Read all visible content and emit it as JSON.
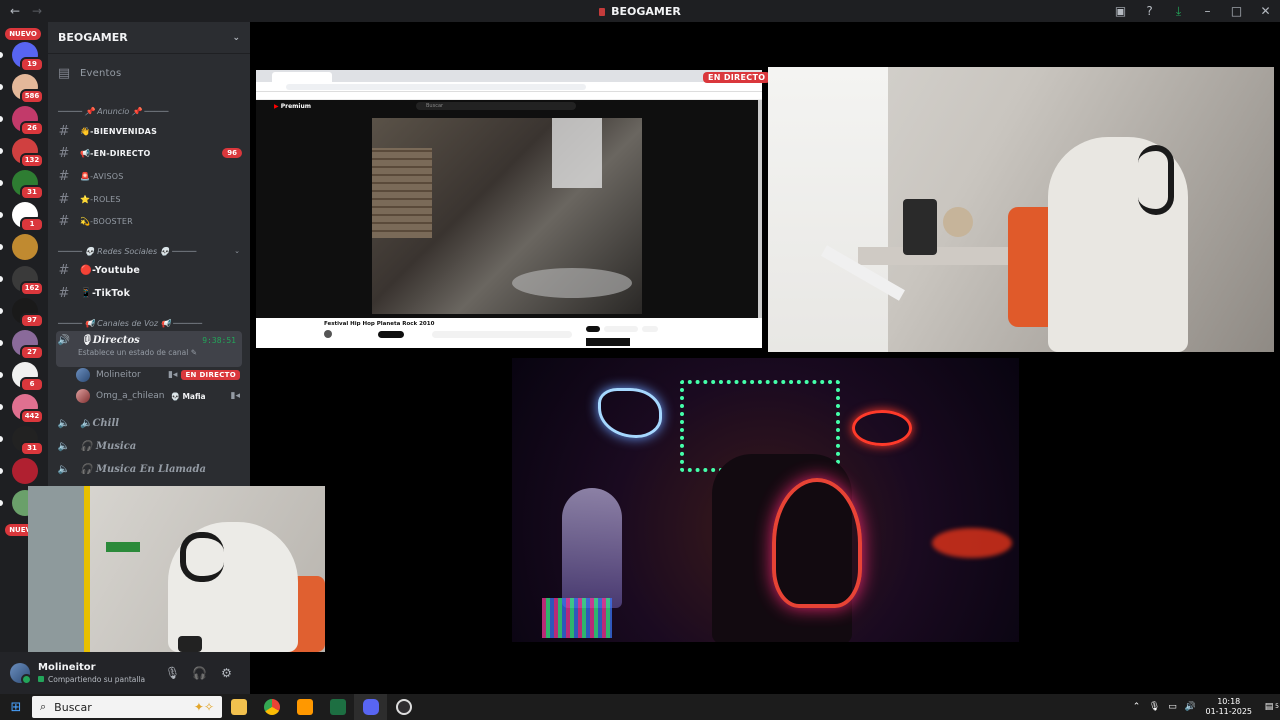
{
  "app": {
    "title": "BEOGAMER"
  },
  "titlebar": {
    "back_icon": "arrow-left-icon",
    "forward_icon": "arrow-right-icon"
  },
  "rail": {
    "top_badge": "NUEVO",
    "servers": [
      {
        "badge": "19",
        "color": "#5865f2"
      },
      {
        "badge": "586",
        "color": "#e4b89a"
      },
      {
        "badge": "26",
        "color": "#c23a6a"
      },
      {
        "badge": "132",
        "color": "#d04040"
      },
      {
        "badge": "31",
        "color": "#2e7d32"
      },
      {
        "badge": "1",
        "color": "#ffffff"
      },
      {
        "badge": "",
        "color": "#c08a30"
      },
      {
        "badge": "162",
        "color": "#3a3a3a"
      },
      {
        "badge": "97",
        "color": "#1a1a1a"
      },
      {
        "badge": "27",
        "color": "#8a6a9a"
      },
      {
        "badge": "6",
        "color": "#f0f0f0"
      },
      {
        "badge": "442",
        "color": "#e07090"
      },
      {
        "badge": "31",
        "color": "#222222"
      },
      {
        "badge": "",
        "color": "#b02030"
      },
      {
        "badge": "",
        "color": "#6aa06a"
      }
    ],
    "bottom_badge": "NUEVO"
  },
  "sidebar": {
    "server_name": "BEOGAMER",
    "events_label": "Eventos",
    "cat_announce": "───── 📌 Anuncio 📌 ─────",
    "channels_announce": [
      {
        "name": "👋-BIENVENIDAS",
        "count": ""
      },
      {
        "name": "📢-EN-DIRECTO",
        "count": "96"
      },
      {
        "name": "🚨-AVISOS",
        "count": ""
      },
      {
        "name": "⭐-ROLES",
        "count": ""
      },
      {
        "name": "💫-BOOSTER",
        "count": ""
      }
    ],
    "cat_social": "───── 💀 Redes Sociales 💀 ─────",
    "channels_social": [
      {
        "name": "🔴-Youtube"
      },
      {
        "name": "📱-TikTok"
      }
    ],
    "cat_voice": "───── 📢 Canales de Voz 📢 ──────",
    "voice_active": {
      "name": "🎙Directos",
      "timer": "9:38:51",
      "status": "Establece un estado de canal"
    },
    "voice_users": [
      {
        "name": "Molineitor",
        "live": "EN DIRECTO"
      },
      {
        "name": "Omg_a_chilean",
        "tag": "💀 Mafia"
      }
    ],
    "voice_channels": [
      "🔈Chill",
      "🎧 Musica",
      "🎧 Musica En Llamada"
    ]
  },
  "user_panel": {
    "name": "Molineitor",
    "status": "Compartiendo su pantalla"
  },
  "stage": {
    "live_label": "EN DIRECTO",
    "yt_video_title": "Festival Hip Hop Planeta Rock 2010",
    "yt_logo": "Premium",
    "yt_search": "Buscar"
  },
  "taskbar": {
    "search_placeholder": "Buscar",
    "time": "10:18",
    "date": "01-11-2025",
    "notif_count": "5"
  }
}
